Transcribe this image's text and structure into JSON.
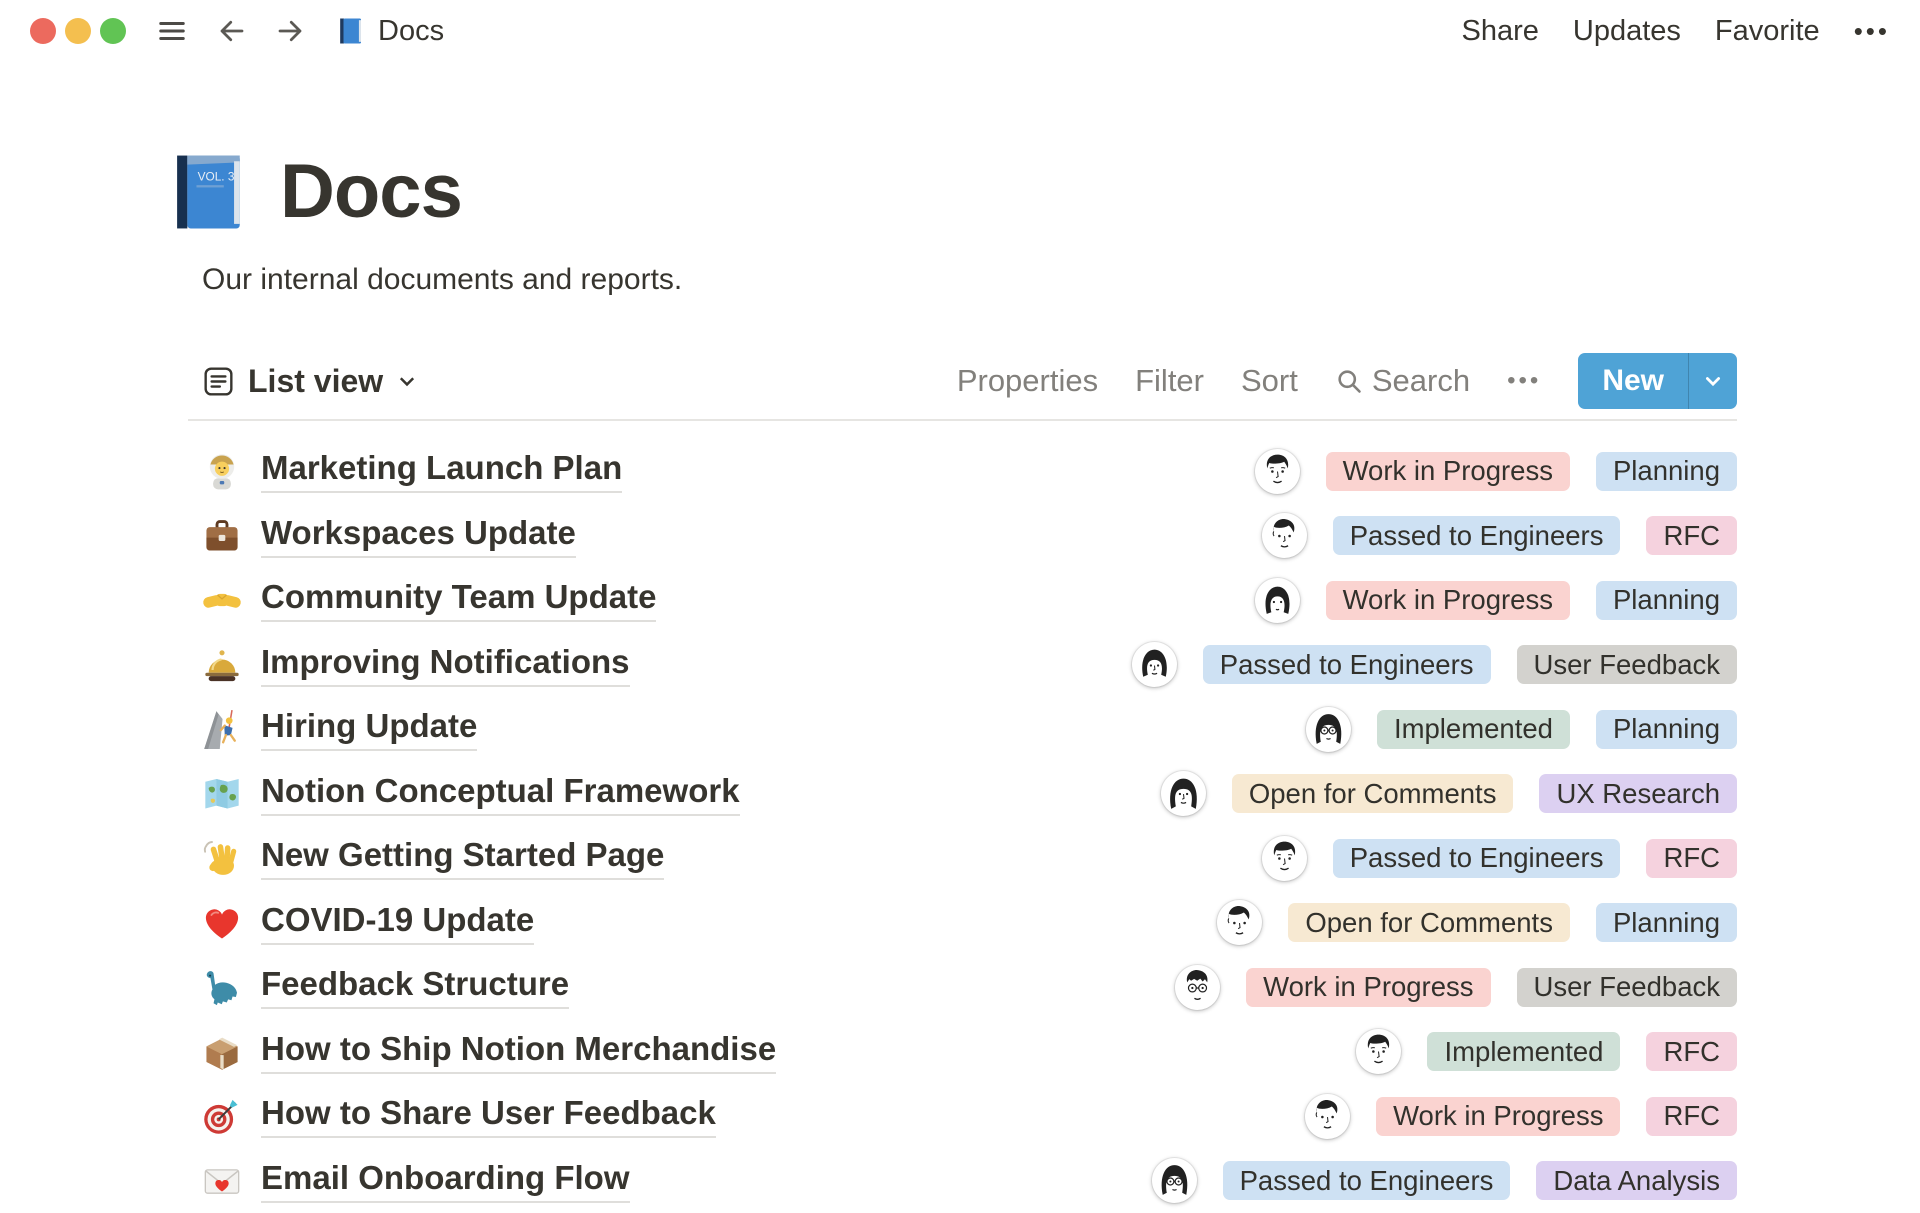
{
  "window": {
    "title": "Docs",
    "icon": "blue-book-icon",
    "actions": {
      "share": "Share",
      "updates": "Updates",
      "favorite": "Favorite",
      "more": "•••"
    }
  },
  "page": {
    "icon": "blue-book-icon",
    "icon_text": "VOL. 3",
    "title": "Docs",
    "subtitle": "Our internal documents and reports."
  },
  "toolbar": {
    "view_label": "List view",
    "properties_label": "Properties",
    "filter_label": "Filter",
    "sort_label": "Sort",
    "search_label": "Search",
    "more_label": "•••",
    "new_label": "New"
  },
  "colors": {
    "accent_blue": "#4FA3D6",
    "badge_red": "#FAD3D0",
    "badge_pink": "#F5D2DE",
    "badge_blue": "#CEE1F3",
    "badge_gray": "#D3D2CE",
    "badge_green": "#CFE0D7",
    "badge_yellow": "#F7E9D2",
    "badge_purple": "#DCD0F1"
  },
  "rows": [
    {
      "emoji": "astronaut-icon",
      "title": "Marketing Launch Plan",
      "avatar": "avatar-man-short-hair",
      "status": {
        "label": "Work in Progress",
        "color": "red"
      },
      "category": {
        "label": "Planning",
        "color": "blue"
      }
    },
    {
      "emoji": "briefcase-icon",
      "title": "Workspaces Update",
      "avatar": "avatar-man-wavy-hair",
      "status": {
        "label": "Passed to Engineers",
        "color": "blue"
      },
      "category": {
        "label": "RFC",
        "color": "pink"
      }
    },
    {
      "emoji": "handshake-icon",
      "title": "Community Team Update",
      "avatar": "avatar-woman-headphones",
      "status": {
        "label": "Work in Progress",
        "color": "red"
      },
      "category": {
        "label": "Planning",
        "color": "blue"
      }
    },
    {
      "emoji": "bellhop-bell-icon",
      "title": "Improving Notifications",
      "avatar": "avatar-woman-bob",
      "status": {
        "label": "Passed to Engineers",
        "color": "blue"
      },
      "category": {
        "label": "User Feedback",
        "color": "gray"
      }
    },
    {
      "emoji": "person-climbing-icon",
      "title": "Hiring Update",
      "avatar": "avatar-woman-glasses",
      "status": {
        "label": "Implemented",
        "color": "green"
      },
      "category": {
        "label": "Planning",
        "color": "blue"
      }
    },
    {
      "emoji": "world-map-icon",
      "title": "Notion Conceptual Framework",
      "avatar": "avatar-woman-long-hair",
      "status": {
        "label": "Open for Comments",
        "color": "yellow"
      },
      "category": {
        "label": "UX Research",
        "color": "purple"
      }
    },
    {
      "emoji": "waving-hand-icon",
      "title": "New Getting Started Page",
      "avatar": "avatar-man-short-hair",
      "status": {
        "label": "Passed to Engineers",
        "color": "blue"
      },
      "category": {
        "label": "RFC",
        "color": "pink"
      }
    },
    {
      "emoji": "red-heart-icon",
      "title": "COVID-19 Update",
      "avatar": "avatar-man-wavy-hair",
      "status": {
        "label": "Open for Comments",
        "color": "yellow"
      },
      "category": {
        "label": "Planning",
        "color": "blue"
      }
    },
    {
      "emoji": "sauropod-icon",
      "title": "Feedback Structure",
      "avatar": "avatar-man-glasses",
      "status": {
        "label": "Work in Progress",
        "color": "red"
      },
      "category": {
        "label": "User Feedback",
        "color": "gray"
      }
    },
    {
      "emoji": "package-icon",
      "title": "How to Ship Notion Merchandise",
      "avatar": "avatar-man-short-hair",
      "status": {
        "label": "Implemented",
        "color": "green"
      },
      "category": {
        "label": "RFC",
        "color": "pink"
      }
    },
    {
      "emoji": "direct-hit-icon",
      "title": "How to Share User Feedback",
      "avatar": "avatar-man-wavy-hair",
      "status": {
        "label": "Work in Progress",
        "color": "red"
      },
      "category": {
        "label": "RFC",
        "color": "pink"
      }
    },
    {
      "emoji": "love-letter-icon",
      "title": "Email Onboarding Flow",
      "avatar": "avatar-woman-glasses",
      "status": {
        "label": "Passed to Engineers",
        "color": "blue"
      },
      "category": {
        "label": "Data Analysis",
        "color": "purple"
      }
    }
  ]
}
